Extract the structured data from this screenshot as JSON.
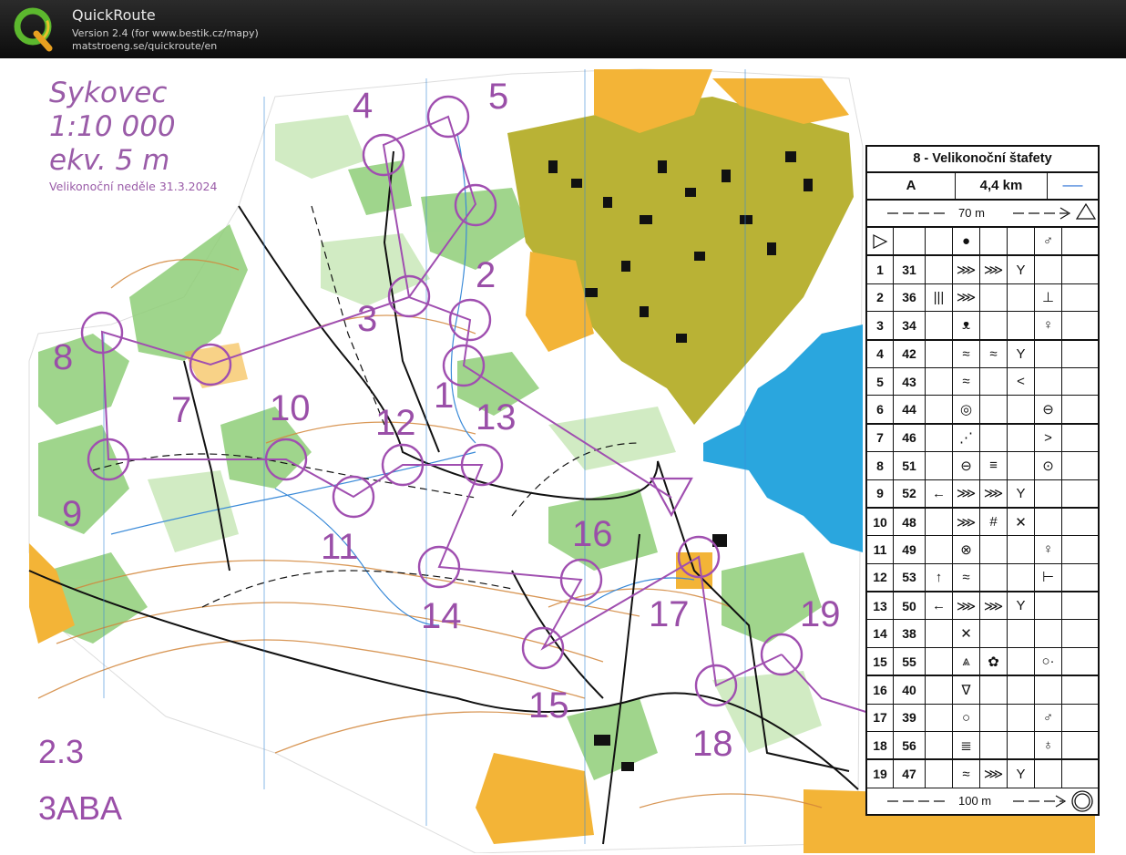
{
  "app": {
    "title": "QuickRoute",
    "version": "Version 2.4  (for www.bestik.cz/mapy)",
    "url": "matstroeng.se/quickroute/en"
  },
  "map": {
    "name": "Sykovec",
    "scale": "1:10 000",
    "contour": "ekv. 5 m",
    "event": "Velikonoční neděle 31.3.2024",
    "course_code": "2.3",
    "course_name": "3ABA",
    "colors": {
      "course": "#a04fb0",
      "forest_green": "#7fc06a",
      "open_yellow": "#f5b83a",
      "olive": "#b8b232",
      "water": "#2aa8e0",
      "contour": "#c8782c",
      "path": "#111111",
      "stream": "#3a8ad8"
    }
  },
  "controls": [
    {
      "number": "1"
    },
    {
      "number": "2"
    },
    {
      "number": "3"
    },
    {
      "number": "4"
    },
    {
      "number": "5"
    },
    {
      "number": "7"
    },
    {
      "number": "8"
    },
    {
      "number": "9"
    },
    {
      "number": "10"
    },
    {
      "number": "11"
    },
    {
      "number": "12"
    },
    {
      "number": "13"
    },
    {
      "number": "14"
    },
    {
      "number": "15"
    },
    {
      "number": "16"
    },
    {
      "number": "17"
    },
    {
      "number": "18"
    },
    {
      "number": "19"
    }
  ],
  "description": {
    "title": "8 - Velikonoční štafety",
    "class": "A",
    "length": "4,4 km",
    "start_distance": "70 m",
    "finish_distance": "100 m",
    "start_symbols": {
      "c4": "●",
      "c7": "♂"
    },
    "rows": [
      {
        "n": "1",
        "code": "31",
        "c3": "",
        "c4": "⋙",
        "c5": "⋙",
        "c6": "Y",
        "c7": ""
      },
      {
        "n": "2",
        "code": "36",
        "c3": "|||",
        "c4": "⋙",
        "c5": "",
        "c6": "",
        "c7": "⊥"
      },
      {
        "n": "3",
        "code": "34",
        "c3": "",
        "c4": "ᴥ",
        "c5": "",
        "c6": "",
        "c7": "♀"
      },
      {
        "n": "4",
        "code": "42",
        "c3": "",
        "c4": "≈",
        "c5": "≈",
        "c6": "Y",
        "c7": ""
      },
      {
        "n": "5",
        "code": "43",
        "c3": "",
        "c4": "≈",
        "c5": "",
        "c6": "<",
        "c7": ""
      },
      {
        "n": "6",
        "code": "44",
        "c3": "",
        "c4": "◎",
        "c5": "",
        "c6": "",
        "c7": "⊖"
      },
      {
        "n": "7",
        "code": "46",
        "c3": "",
        "c4": "⋰",
        "c5": "",
        "c6": "",
        "c7": ">"
      },
      {
        "n": "8",
        "code": "51",
        "c3": "",
        "c4": "⊖",
        "c5": "≡",
        "c6": "",
        "c7": "⊙"
      },
      {
        "n": "9",
        "code": "52",
        "c3": "←",
        "c4": "⋙",
        "c5": "⋙",
        "c6": "Y",
        "c7": ""
      },
      {
        "n": "10",
        "code": "48",
        "c3": "",
        "c4": "⋙",
        "c5": "#",
        "c6": "✕",
        "c7": ""
      },
      {
        "n": "11",
        "code": "49",
        "c3": "",
        "c4": "⊗",
        "c5": "",
        "c6": "",
        "c7": "♀"
      },
      {
        "n": "12",
        "code": "53",
        "c3": "↑",
        "c4": "≈",
        "c5": "",
        "c6": "",
        "c7": "⊢"
      },
      {
        "n": "13",
        "code": "50",
        "c3": "←",
        "c4": "⋙",
        "c5": "⋙",
        "c6": "Y",
        "c7": ""
      },
      {
        "n": "14",
        "code": "38",
        "c3": "",
        "c4": "✕",
        "c5": "",
        "c6": "",
        "c7": ""
      },
      {
        "n": "15",
        "code": "55",
        "c3": "",
        "c4": "⩓",
        "c5": "✿",
        "c6": "",
        "c7": "○·"
      },
      {
        "n": "16",
        "code": "40",
        "c3": "",
        "c4": "∇",
        "c5": "",
        "c6": "",
        "c7": ""
      },
      {
        "n": "17",
        "code": "39",
        "c3": "",
        "c4": "○",
        "c5": "",
        "c6": "",
        "c7": "♂"
      },
      {
        "n": "18",
        "code": "56",
        "c3": "",
        "c4": "≣",
        "c5": "",
        "c6": "",
        "c7": "♁"
      },
      {
        "n": "19",
        "code": "47",
        "c3": "",
        "c4": "≈",
        "c5": "⋙",
        "c6": "Y",
        "c7": ""
      }
    ]
  }
}
